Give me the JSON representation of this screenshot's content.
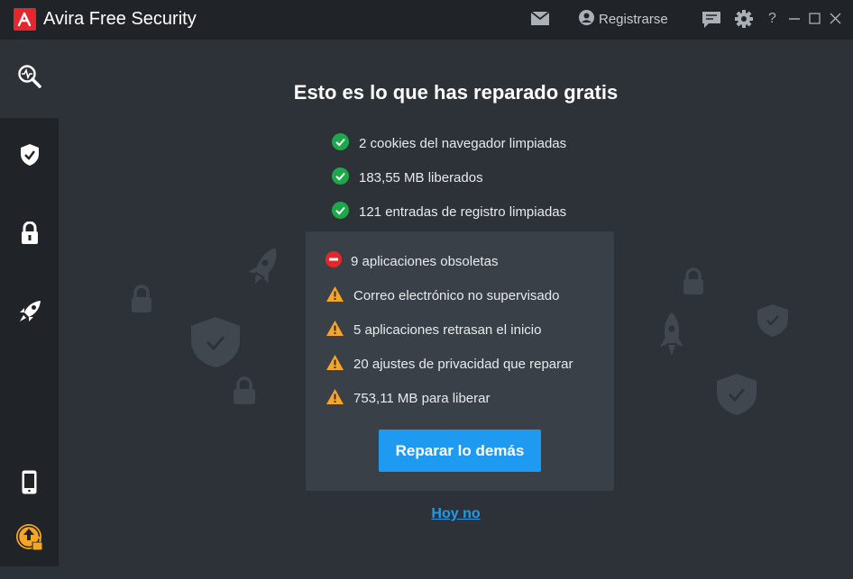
{
  "titlebar": {
    "brand": "Avira",
    "product": "Free Security",
    "register_label": "Registrarse",
    "help_label": "?"
  },
  "sidebar": {
    "items": [
      {
        "icon": "scan-pulse-icon",
        "active": true
      },
      {
        "icon": "shield-check-icon",
        "active": false
      },
      {
        "icon": "padlock-icon",
        "active": false
      },
      {
        "icon": "rocket-icon",
        "active": false
      },
      {
        "icon": "mobile-phone-icon",
        "active": false
      },
      {
        "icon": "upgrade-lock-icon",
        "active": false
      }
    ]
  },
  "main": {
    "heading": "Esto es lo que has reparado gratis",
    "fixed": [
      "2 cookies del navegador limpiadas",
      "183,55 MB liberados",
      "121 entradas de registro limpiadas"
    ],
    "issues": [
      {
        "icon": "block-icon",
        "text": "9 aplicaciones obsoletas"
      },
      {
        "icon": "warning-icon",
        "text": "Correo electrónico no supervisado"
      },
      {
        "icon": "warning-icon",
        "text": "5 aplicaciones retrasan el inicio"
      },
      {
        "icon": "warning-icon",
        "text": "20 ajustes de privacidad que reparar"
      },
      {
        "icon": "warning-icon",
        "text": "753,11 MB para liberar"
      }
    ],
    "primary_button": "Reparar lo demás",
    "secondary_link": "Hoy no"
  },
  "colors": {
    "accent": "#1e9bf0",
    "success": "#1fa84a",
    "warning": "#f5a623",
    "error": "#e5262b",
    "brand": "#e5262b"
  }
}
